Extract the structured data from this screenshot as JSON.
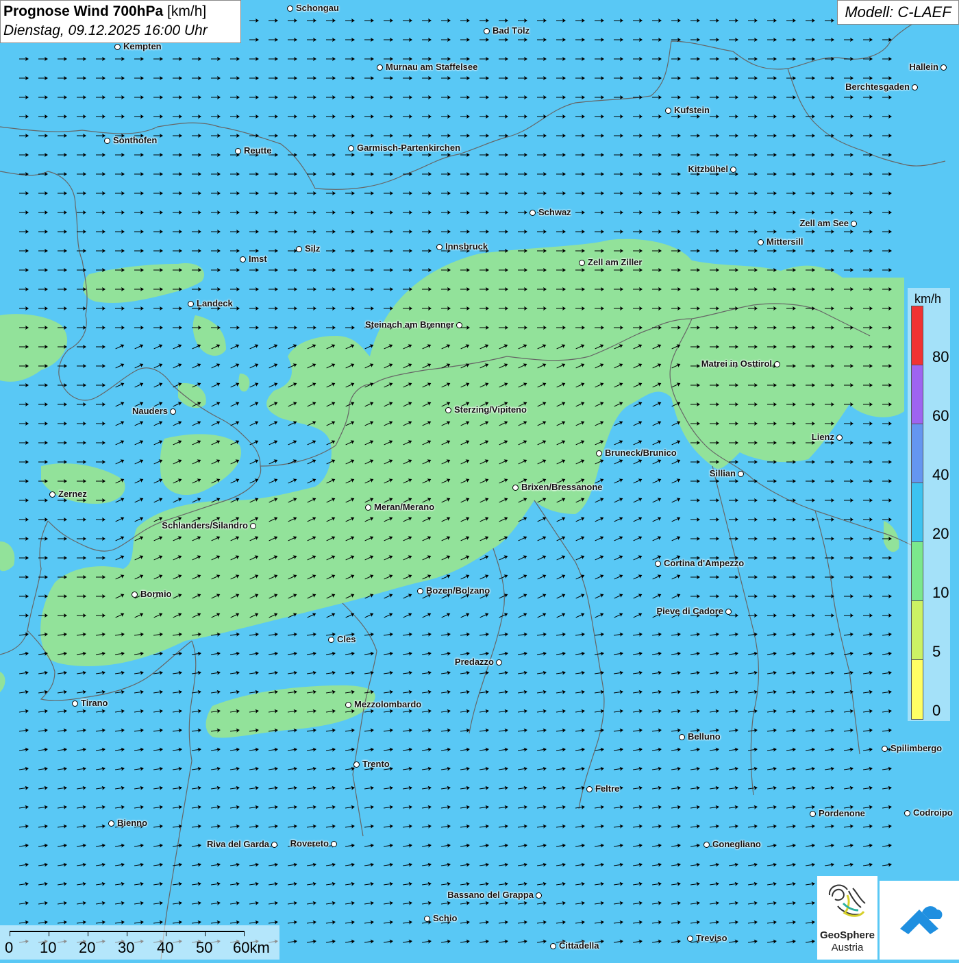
{
  "header": {
    "title_bold": "Prognose Wind 700hPa",
    "title_unit": "[km/h]",
    "datetime": "Dienstag, 09.12.2025 16:00 Uhr",
    "model": "Modell: C-LAEF"
  },
  "legend": {
    "unit": "km/h",
    "labels": [
      "80",
      "60",
      "40",
      "20",
      "10",
      "5",
      "0"
    ],
    "colors": [
      "#f03232",
      "#9e64f0",
      "#6496f0",
      "#3cc3f0",
      "#7be88c",
      "#ccf264",
      "#ffff64"
    ]
  },
  "scale": {
    "labels": [
      "0",
      "10",
      "20",
      "30",
      "40",
      "50",
      "60km"
    ]
  },
  "logos": {
    "geosphere_line1": "GeoSphere",
    "geosphere_line2": "Austria"
  },
  "map_colors": {
    "background": "#59c8f5",
    "calm_zone": "#92e29a",
    "borders": "#666666",
    "arrows": "#000000"
  },
  "cities": [
    {
      "name": "Schongau",
      "label_side": "right"
    },
    {
      "name": "Bad Tölz",
      "label_side": "right"
    },
    {
      "name": "Kempten",
      "label_side": "right"
    },
    {
      "name": "Murnau am Staffelsee",
      "label_side": "right"
    },
    {
      "name": "Hallein",
      "label_side": "left"
    },
    {
      "name": "Berchtesgaden",
      "label_side": "left"
    },
    {
      "name": "Kufstein",
      "label_side": "right"
    },
    {
      "name": "Sonthofen",
      "label_side": "right"
    },
    {
      "name": "Reutte",
      "label_side": "right"
    },
    {
      "name": "Garmisch-Partenkirchen",
      "label_side": "right"
    },
    {
      "name": "Kitzbühel",
      "label_side": "left"
    },
    {
      "name": "Schwaz",
      "label_side": "right"
    },
    {
      "name": "Zell am See",
      "label_side": "left"
    },
    {
      "name": "Mittersill",
      "label_side": "right"
    },
    {
      "name": "Innsbruck",
      "label_side": "right"
    },
    {
      "name": "Silz",
      "label_side": "right"
    },
    {
      "name": "Imst",
      "label_side": "right"
    },
    {
      "name": "Zell am Ziller",
      "label_side": "right"
    },
    {
      "name": "Landeck",
      "label_side": "right"
    },
    {
      "name": "Steinach am Brenner",
      "label_side": "left"
    },
    {
      "name": "Matrei in Osttirol",
      "label_side": "left"
    },
    {
      "name": "Nauders",
      "label_side": "left"
    },
    {
      "name": "Sterzing/Vipiteno",
      "label_side": "right"
    },
    {
      "name": "Lienz",
      "label_side": "left"
    },
    {
      "name": "Bruneck/Brunico",
      "label_side": "right"
    },
    {
      "name": "Sillian",
      "label_side": "left"
    },
    {
      "name": "Zernez",
      "label_side": "right"
    },
    {
      "name": "Brixen/Bressanone",
      "label_side": "right"
    },
    {
      "name": "Meran/Merano",
      "label_side": "right"
    },
    {
      "name": "Schlanders/Silandro",
      "label_side": "left"
    },
    {
      "name": "Cortina d'Ampezzo",
      "label_side": "right"
    },
    {
      "name": "Bormio",
      "label_side": "right"
    },
    {
      "name": "Bozen/Bolzano",
      "label_side": "right"
    },
    {
      "name": "Pieve di Cadore",
      "label_side": "left"
    },
    {
      "name": "Cles",
      "label_side": "right"
    },
    {
      "name": "Predazzo",
      "label_side": "left"
    },
    {
      "name": "Tirano",
      "label_side": "right"
    },
    {
      "name": "Mezzolombardo",
      "label_side": "right"
    },
    {
      "name": "Belluno",
      "label_side": "right"
    },
    {
      "name": "Spilimbergo",
      "label_side": "right"
    },
    {
      "name": "Trento",
      "label_side": "right"
    },
    {
      "name": "Feltre",
      "label_side": "right"
    },
    {
      "name": "Pordenone",
      "label_side": "right"
    },
    {
      "name": "Codroipo",
      "label_side": "right"
    },
    {
      "name": "Bienno",
      "label_side": "right"
    },
    {
      "name": "Riva del Garda",
      "label_side": "left"
    },
    {
      "name": "Rovereto",
      "label_side": "left"
    },
    {
      "name": "Conegliano",
      "label_side": "right"
    },
    {
      "name": "Bassano del Grappa",
      "label_side": "left"
    },
    {
      "name": "Schio",
      "label_side": "right"
    },
    {
      "name": "Treviso",
      "label_side": "right"
    },
    {
      "name": "Cittadella",
      "label_side": "right"
    }
  ]
}
